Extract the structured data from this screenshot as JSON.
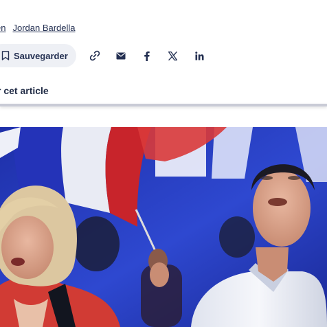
{
  "tags": [
    "en",
    "Jordan Bardella"
  ],
  "actions": {
    "save_label": "Sauvegarder",
    "share_icons": [
      "link-icon",
      "mail-icon",
      "facebook-icon",
      "x-icon",
      "linkedin-icon"
    ]
  },
  "section": {
    "title": "r cet article"
  },
  "colors": {
    "text": "#1f2a44",
    "button_bg": "#eef0f5",
    "divider": "#c9cbd6",
    "stage_blue": "#2a3fc4",
    "flag_red": "#c8242b"
  }
}
